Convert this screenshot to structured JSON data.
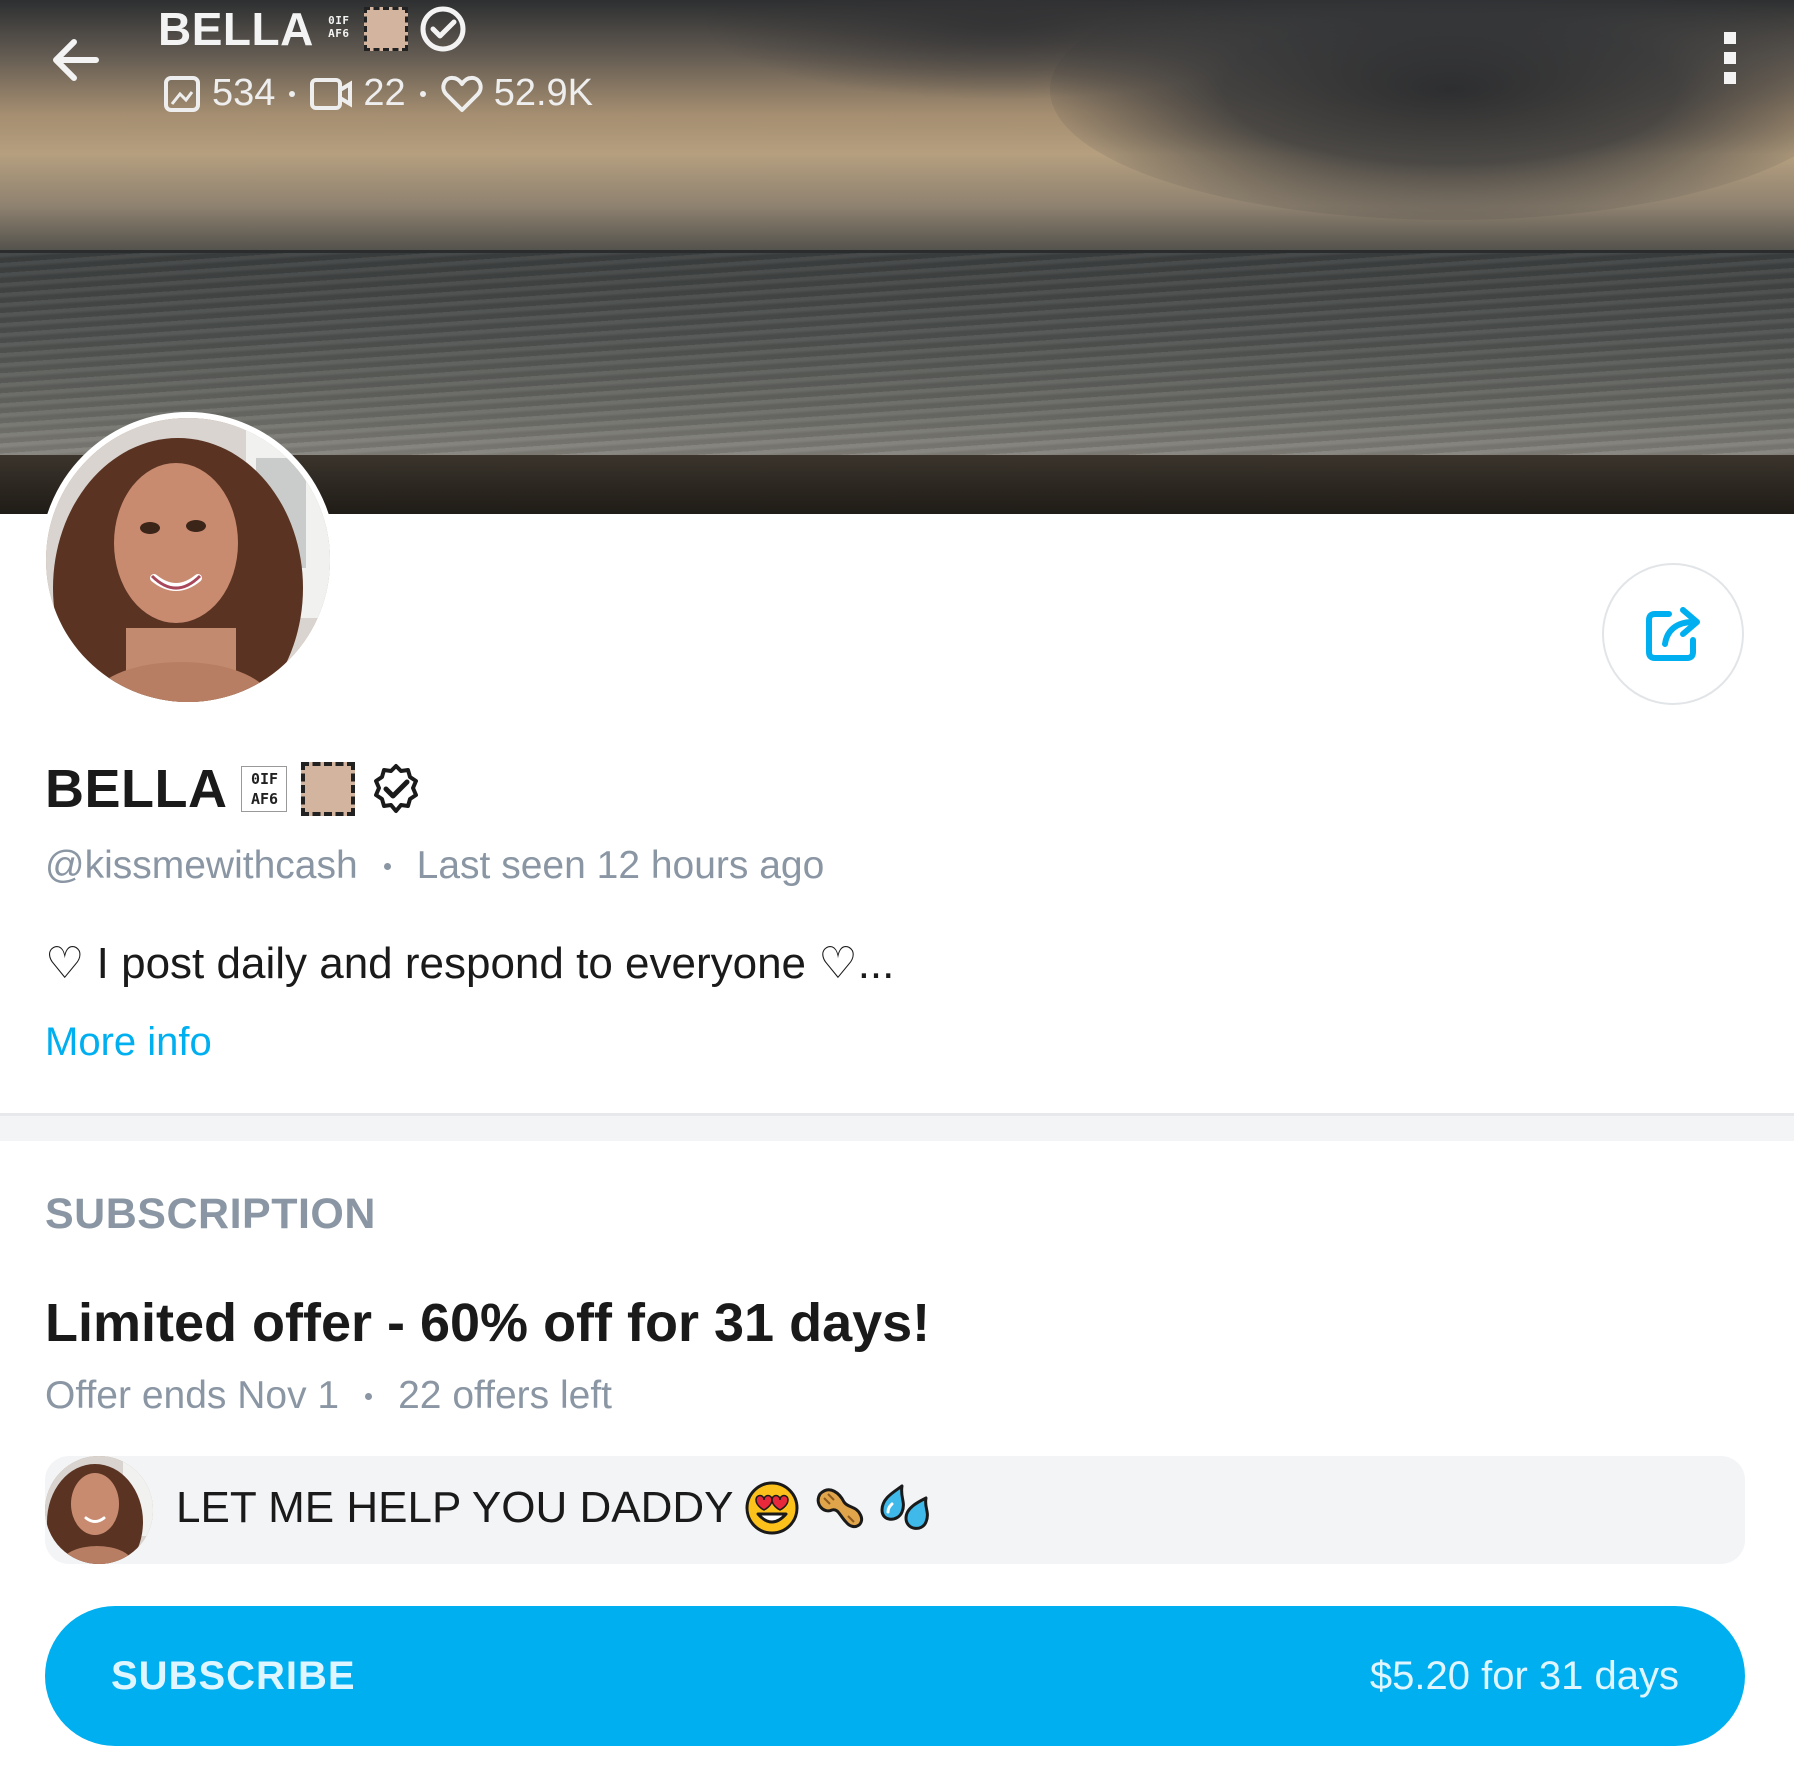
{
  "header": {
    "name": "BELLA",
    "tag_glyph": "0IF\nAF6",
    "stats": {
      "posts": "534",
      "videos": "22",
      "likes": "52.9K"
    }
  },
  "profile": {
    "name": "BELLA",
    "tag_glyph": "0IF\nAF6",
    "handle": "@kissmewithcash",
    "last_seen": "Last seen 12 hours ago",
    "bio": "♡ I post daily and respond to everyone ♡...",
    "more_info": "More info"
  },
  "subscription": {
    "heading": "SUBSCRIPTION",
    "offer_title": "Limited offer - 60% off for 31 days!",
    "offer_ends": "Offer ends Nov 1",
    "offers_left": "22 offers left",
    "message": "LET ME HELP YOU DADDY",
    "button_label": "SUBSCRIBE",
    "button_price": "$5.20 for 31 days"
  },
  "colors": {
    "accent": "#00aff0",
    "muted_text": "#8a96a3",
    "primary_text": "#1a1a1a"
  },
  "icons": {
    "back": "arrow-left-icon",
    "verified": "verified-badge-icon",
    "posts": "image-icon",
    "videos": "video-icon",
    "likes": "heart-icon",
    "menu": "vertical-dots-icon",
    "share": "share-icon",
    "emoji_1": "heart-eyes-emoji",
    "emoji_2": "peanut-emoji",
    "emoji_3": "sweat-droplets-emoji"
  }
}
